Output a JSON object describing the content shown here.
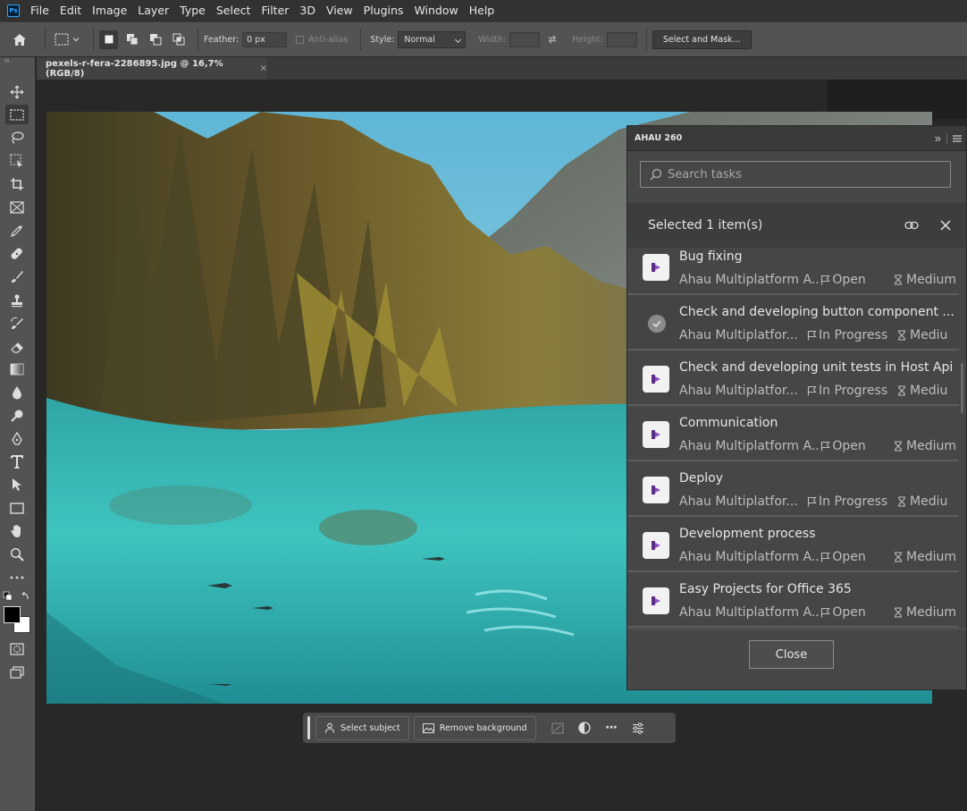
{
  "app": {
    "logo": "Ps",
    "menu": [
      "File",
      "Edit",
      "Image",
      "Layer",
      "Type",
      "Select",
      "Filter",
      "3D",
      "View",
      "Plugins",
      "Window",
      "Help"
    ]
  },
  "options": {
    "feather_label": "Feather:",
    "feather_value": "0 px",
    "antialias_label": "Anti-alias",
    "style_label": "Style:",
    "style_value": "Normal",
    "width_label": "Width:",
    "height_label": "Height:",
    "select_mask_label": "Select and Mask..."
  },
  "document": {
    "tab_title": "pexels-r-fera-2286895.jpg @ 16,7% (RGB/8)",
    "tab_close": "×"
  },
  "contextbar": {
    "select_subject": "Select subject",
    "remove_background": "Remove background",
    "more": "···"
  },
  "panel": {
    "title": "AHAU 260",
    "collapse": "»",
    "search_placeholder": "Search tasks",
    "selected_text": "Selected 1 item(s)",
    "close_label": "Close",
    "tasks": [
      {
        "name": "Bug fixing",
        "project": "Ahau Multiplatform A...",
        "status": "Open",
        "priority": "Medium",
        "checked": false
      },
      {
        "name": "Check and developing button component ...",
        "project": "Ahau Multiplatfor...",
        "status": "In Progress",
        "priority": "Mediu",
        "checked": true
      },
      {
        "name": "Check and developing unit tests in Host Api",
        "project": "Ahau Multiplatfor...",
        "status": "In Progress",
        "priority": "Mediu",
        "checked": false
      },
      {
        "name": "Communication",
        "project": "Ahau Multiplatform A...",
        "status": "Open",
        "priority": "Medium",
        "checked": false
      },
      {
        "name": "Deploy",
        "project": "Ahau Multiplatfor...",
        "status": "In Progress",
        "priority": "Mediu",
        "checked": false
      },
      {
        "name": "Development process",
        "project": "Ahau Multiplatform A...",
        "status": "Open",
        "priority": "Medium",
        "checked": false
      },
      {
        "name": "Easy Projects for Office 365",
        "project": "Ahau Multiplatform A...",
        "status": "Open",
        "priority": "Medium",
        "checked": false
      }
    ]
  },
  "colors": {
    "app_bg": "#282828",
    "panel_bg": "#474747",
    "accent_purple": "#5b2d86",
    "ps_blue": "#31a8ff"
  }
}
